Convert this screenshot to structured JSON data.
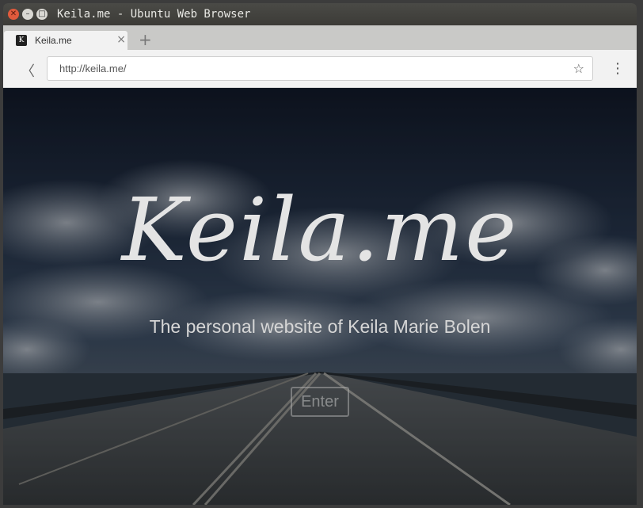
{
  "window": {
    "title": "Keila.me - Ubuntu Web Browser"
  },
  "tab": {
    "label": "Keila.me",
    "favicon_text": "K"
  },
  "addressbar": {
    "url": "http://keila.me/"
  },
  "hero": {
    "title": "Keila.me",
    "tagline": "The personal website of Keila Marie Bolen",
    "enter_label": "Enter"
  },
  "colors": {
    "sky_top": "#111827",
    "sky_mid": "#2c3e55",
    "road": "#4a4e52"
  }
}
